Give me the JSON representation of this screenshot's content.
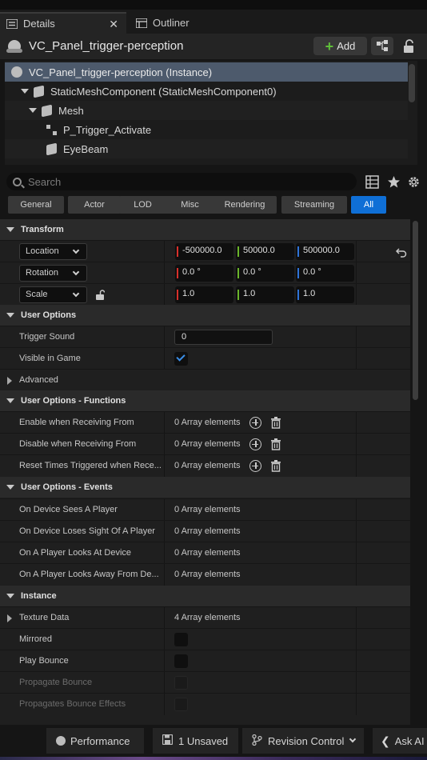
{
  "tabs": [
    {
      "label": "Details",
      "icon": "details-icon",
      "active": true
    },
    {
      "label": "Outliner",
      "icon": "outliner-icon",
      "active": false
    }
  ],
  "header": {
    "title": "VC_Panel_trigger-perception",
    "add_label": "Add"
  },
  "tree": {
    "items": [
      {
        "label": "VC_Panel_trigger-perception (Instance)",
        "icon": "actor-icon"
      },
      {
        "label": "StaticMeshComponent (StaticMeshComponent0)",
        "icon": "mesh-component-icon"
      },
      {
        "label": "Mesh",
        "icon": "mesh-component-icon"
      },
      {
        "label": "P_Trigger_Activate",
        "icon": "particle-icon"
      },
      {
        "label": "EyeBeam",
        "icon": "mesh-component-icon"
      }
    ]
  },
  "search": {
    "placeholder": "Search"
  },
  "filters": [
    "General",
    "Actor",
    "LOD",
    "Misc",
    "Rendering",
    "Streaming",
    "All"
  ],
  "filter_active": "All",
  "sections": {
    "transform": {
      "title": "Transform",
      "location": {
        "mode": "Location",
        "x": "-500000.0",
        "y": "50000.0",
        "z": "500000.0"
      },
      "rotation": {
        "mode": "Rotation",
        "x": "0.0 °",
        "y": "0.0 °",
        "z": "0.0 °"
      },
      "scale": {
        "mode": "Scale",
        "x": "1.0",
        "y": "1.0",
        "z": "1.0"
      }
    },
    "user_options": {
      "title": "User Options",
      "trigger_sound_label": "Trigger Sound",
      "trigger_sound_value": "0",
      "visible_label": "Visible in Game",
      "visible_checked": true,
      "advanced_label": "Advanced"
    },
    "functions": {
      "title": "User Options - Functions",
      "rows": [
        {
          "label": "Enable when Receiving From",
          "value": "0 Array elements"
        },
        {
          "label": "Disable when Receiving From",
          "value": "0 Array elements"
        },
        {
          "label": "Reset Times Triggered when Rece...",
          "value": "0 Array elements"
        }
      ]
    },
    "events": {
      "title": "User Options - Events",
      "rows": [
        {
          "label": "On Device Sees A Player",
          "value": "0 Array elements"
        },
        {
          "label": "On Device Loses Sight Of A Player",
          "value": "0 Array elements"
        },
        {
          "label": "On A Player Looks At Device",
          "value": "0 Array elements"
        },
        {
          "label": "On A Player Looks Away From De...",
          "value": "0 Array elements"
        }
      ]
    },
    "instance": {
      "title": "Instance",
      "texture_label": "Texture Data",
      "texture_value": "4 Array elements",
      "mirrored_label": "Mirrored",
      "play_bounce_label": "Play Bounce",
      "propagate_bounce_label": "Propagate Bounce",
      "propagates_effects_label": "Propagates Bounce Effects"
    }
  },
  "statusbar": {
    "performance": "Performance",
    "unsaved": "1 Unsaved",
    "revision": "Revision Control",
    "ask_ai": "Ask AI"
  },
  "colors": {
    "accent": "#0f6fd6",
    "x_axis": "#d8302b",
    "y_axis": "#6ab52a",
    "z_axis": "#2e73d8",
    "add_plus": "#5fbf3a"
  }
}
